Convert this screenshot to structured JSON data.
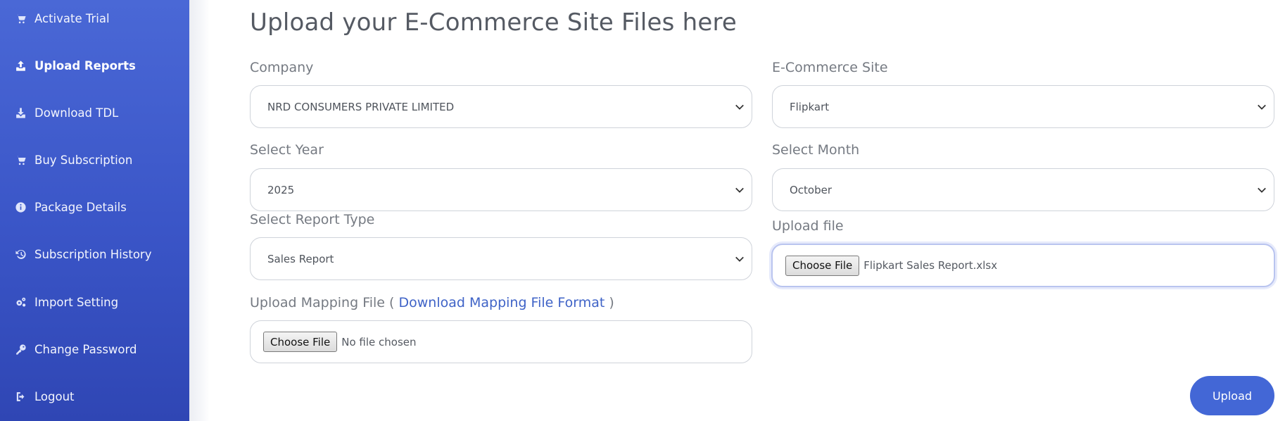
{
  "sidebar": {
    "items": [
      {
        "label": "Activate Trial",
        "icon": "cart-icon"
      },
      {
        "label": "Upload Reports",
        "icon": "upload-icon",
        "active": true
      },
      {
        "label": "Download TDL",
        "icon": "download-icon"
      },
      {
        "label": "Buy Subscription",
        "icon": "cart-icon"
      },
      {
        "label": "Package Details",
        "icon": "info-icon"
      },
      {
        "label": "Subscription History",
        "icon": "history-icon"
      },
      {
        "label": "Import Setting",
        "icon": "gears-icon"
      },
      {
        "label": "Change Password",
        "icon": "key-icon"
      },
      {
        "label": "Logout",
        "icon": "logout-icon"
      }
    ]
  },
  "main": {
    "title": "Upload your E-Commerce Site Files here",
    "company": {
      "label": "Company",
      "value": "NRD CONSUMERS PRIVATE LIMITED"
    },
    "site": {
      "label": "E-Commerce Site",
      "value": "Flipkart"
    },
    "year": {
      "label": "Select Year",
      "value": "2025"
    },
    "month": {
      "label": "Select Month",
      "value": "October"
    },
    "report_type": {
      "label": "Select Report Type",
      "value": "Sales Report"
    },
    "upload_file": {
      "label": "Upload file",
      "button": "Choose File",
      "filename": "Flipkart Sales Report.xlsx"
    },
    "mapping_file": {
      "label_prefix": "Upload Mapping File (",
      "link": "Download Mapping File Format",
      "label_suffix": ")",
      "button": "Choose File",
      "filename": "No file chosen"
    },
    "upload_button": "Upload"
  },
  "colors": {
    "sidebar_top": "#4a68d6",
    "sidebar_bottom": "#2f46b4",
    "accent": "#4367d6",
    "link": "#3f63c7"
  }
}
